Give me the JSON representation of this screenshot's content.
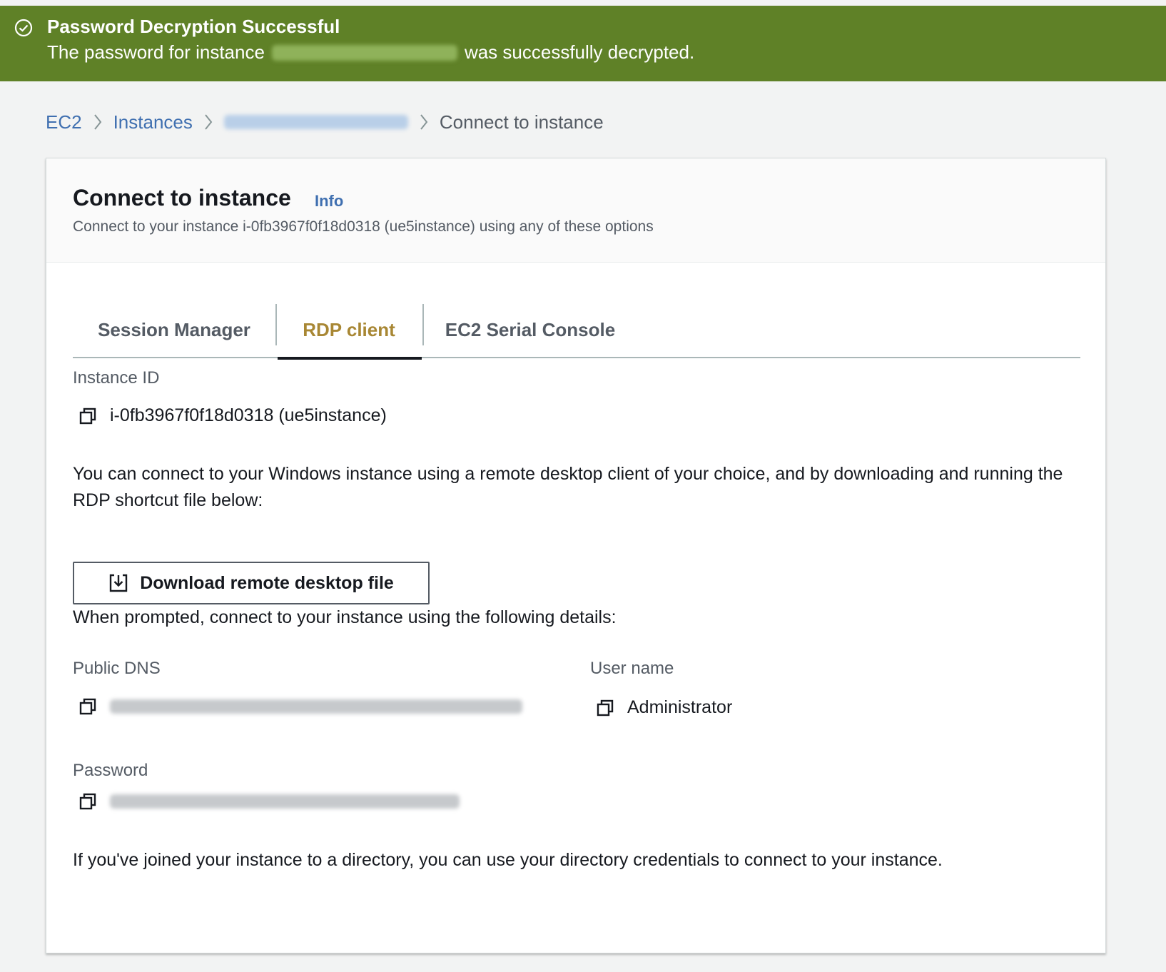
{
  "flash": {
    "title": "Password Decryption Successful",
    "message_prefix": "The password for instance",
    "message_suffix": "was successfully decrypted.",
    "status_color": "#5f8127",
    "icon": "check-circle-icon"
  },
  "breadcrumb": {
    "items": [
      "EC2",
      "Instances"
    ],
    "current": "Connect to instance",
    "separator_icon": "chevron-right-icon"
  },
  "card": {
    "title": "Connect to instance",
    "info_label": "Info",
    "description": "Connect to your instance i-0fb3967f0f18d0318 (ue5instance) using any of these options"
  },
  "tabs": [
    {
      "label": "Session Manager",
      "active": false
    },
    {
      "label": "RDP client",
      "active": true
    },
    {
      "label": "EC2 Serial Console",
      "active": false
    }
  ],
  "rdp": {
    "instance_id_label": "Instance ID",
    "instance_id_value": "i-0fb3967f0f18d0318 (ue5instance)",
    "intro_text": "You can connect to your Windows instance using a remote desktop client of your choice, and by downloading and running the RDP shortcut file below:",
    "download_button_label": "Download remote desktop file",
    "prompt_text": "When prompted, connect to your instance using the following details:",
    "public_dns_label": "Public DNS",
    "user_name_label": "User name",
    "user_name_value": "Administrator",
    "password_label": "Password",
    "directory_text": "If you've joined your instance to a directory, you can use your directory credentials to connect to your instance.",
    "copy_icon": "copy-icon",
    "download_icon": "download-icon"
  },
  "colors": {
    "link": "#3f6fb0",
    "active_tab": "#a88734",
    "page_bg": "#f2f3f3"
  }
}
